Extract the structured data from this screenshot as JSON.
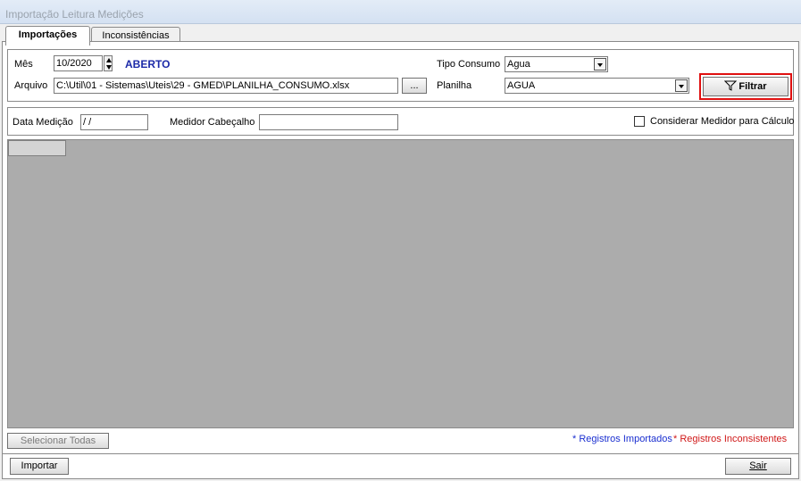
{
  "window": {
    "title": "Importação Leitura Medições"
  },
  "tabs": [
    {
      "label": "Importações"
    },
    {
      "label": "Inconsistências"
    }
  ],
  "filters": {
    "mes_label": "Mês",
    "mes_value": "10/2020",
    "status": "ABERTO",
    "arquivo_label": "Arquivo",
    "arquivo_value": "C:\\Util\\01 - Sistemas\\Uteis\\29 - GMED\\PLANILHA_CONSUMO.xlsx",
    "browse_label": "...",
    "tipo_consumo_label": "Tipo Consumo",
    "tipo_consumo_value": "Agua",
    "planilha_label": "Planilha",
    "planilha_value": "AGUA",
    "filtrar_label": "Filtrar"
  },
  "options": {
    "data_medicao_label": "Data Medição",
    "data_medicao_value": " /  /",
    "medidor_cabecalho_label": "Medidor Cabeçalho",
    "medidor_cabecalho_value": "",
    "considerar_label": "Considerar Medidor para Cálculo"
  },
  "footer": {
    "selecionar_todas_label": "Selecionar Todas",
    "legend_importados": "* Registros Importados",
    "legend_inconsistentes": "* Registros Inconsistentes",
    "importar_label": "Importar",
    "sair_label": "Sair"
  },
  "colors": {
    "status": "#1c2aa8",
    "importados": "#1a2fd0",
    "inconsistentes": "#d01818",
    "highlight": "#e01010"
  }
}
